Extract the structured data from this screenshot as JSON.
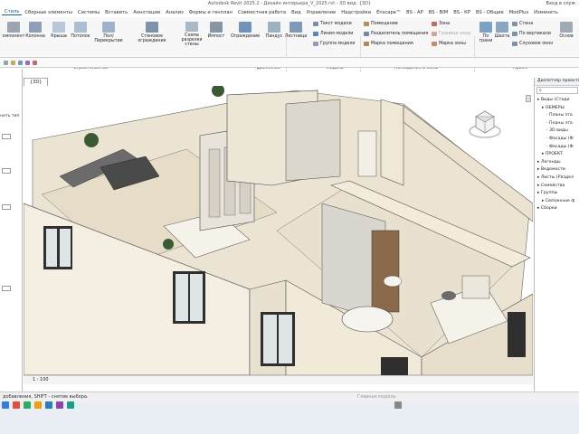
{
  "window": {
    "title": "Autodesk Revit 2025.2 - Дизайн интерьера_V_2025.rvt - 3D вид: {3D}",
    "signin": "Вход в служ"
  },
  "menu": {
    "tabs": [
      "Стиль",
      "Сборные элементы",
      "Системы",
      "Вставить",
      "Аннотации",
      "Анализ",
      "Формы и генплан",
      "Совместная работа",
      "Вид",
      "Управление",
      "Надстройки",
      "Enscape™",
      "BS - АР",
      "BS - BIM",
      "BS - КР",
      "BS - Общие",
      "ModPlus",
      "Изменить"
    ]
  },
  "ribbon": {
    "buttons": [
      {
        "label": "омпонент",
        "color": "#9aa5b0"
      },
      {
        "label": "Колонна",
        "color": "#8ea0b8"
      },
      {
        "label": "Крыша",
        "color": "#b7c8d9"
      },
      {
        "label": "Потолок",
        "color": "#a9bfd3"
      },
      {
        "label": "Пол/Перекрытие",
        "color": "#9cb3c9"
      },
      {
        "label": "Стеновое ограждение",
        "color": "#7d93aa"
      },
      {
        "label": "Схема разрезки стены",
        "color": "#a7b8c7"
      },
      {
        "label": "Импост",
        "color": "#8795a5"
      },
      {
        "label": "Ограждение",
        "color": "#6f94b8"
      },
      {
        "label": "Пандус",
        "color": "#9db1c3"
      },
      {
        "label": "Лестница",
        "color": "#7f9ab4"
      }
    ],
    "model_items": [
      "Текст модели",
      "Линия модели",
      "Группа модели"
    ],
    "room_items": [
      "Помещение",
      "Разделитель помещения",
      "Марка помещения"
    ],
    "zone_items": [
      "Зона",
      "Граница зоны",
      "Марка зоны"
    ],
    "opening_buttons": [
      "По грани",
      "Шахта"
    ],
    "opening_items": [
      "Стена",
      "По вертикали",
      "Слуховое окно"
    ],
    "ref_button": "Основ",
    "panels": {
      "build": "Строительство",
      "circulation": "Движение",
      "model": "Модель",
      "room": "Помещения и зоны",
      "openings": "Проем"
    }
  },
  "properties": {
    "lines": [
      "",
      "нить тип",
      "",
      "",
      "",
      ""
    ]
  },
  "view": {
    "tab": "{3D}",
    "scale": "1 : 100"
  },
  "browser": {
    "header": "Диспетчер проекта",
    "search_placeholder": "",
    "items": [
      {
        "label": "Виды (Стади",
        "level": 0
      },
      {
        "label": "ОБМЕРЫ",
        "level": 1
      },
      {
        "label": "Планы эта",
        "level": 2
      },
      {
        "label": "Планы эта",
        "level": 2
      },
      {
        "label": "3D виды",
        "level": 2
      },
      {
        "label": "Фасады (Ф",
        "level": 2
      },
      {
        "label": "Фасады (Ф",
        "level": 2
      },
      {
        "label": "ПРОЕКТ",
        "level": 1
      },
      {
        "label": "Легенды",
        "level": 0
      },
      {
        "label": "Ведомости",
        "level": 0
      },
      {
        "label": "Листы (Раздел",
        "level": 0
      },
      {
        "label": "Семейства",
        "level": 0
      },
      {
        "label": "Группы",
        "level": 0
      },
      {
        "label": "Связанные ф",
        "level": 1
      },
      {
        "label": "Сборки",
        "level": 0
      }
    ]
  },
  "status": {
    "left": "добавления, SHIFT - снятие выбора.",
    "middle": "Главная модель"
  },
  "colors": {
    "accent": "#0a5eb5",
    "wall": "#f4efe2",
    "floor": "#e6dcc7",
    "wood": "#8a6a4a"
  }
}
